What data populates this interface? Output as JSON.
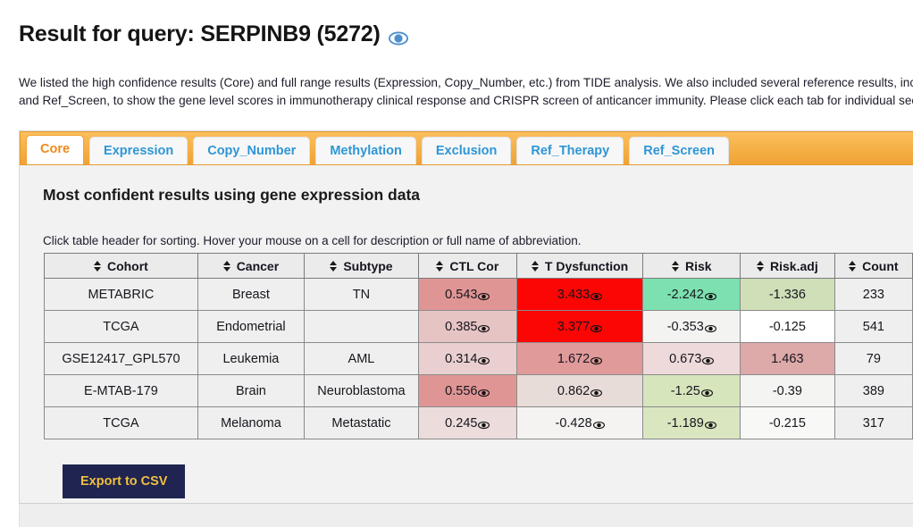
{
  "header": {
    "title": "Result for query: SERPINB9 (5272)",
    "title_eye_icon": "eye-icon",
    "description_line1": "We listed the high confidence results (Core) and full range results (Expression, Copy_Number, etc.) from TIDE analysis. We also included several reference results, incl",
    "description_line2": "and Ref_Screen, to show the gene level scores in immunotherapy clinical response and CRISPR screen of anticancer immunity. Please click each tab for individual secti"
  },
  "tabs": {
    "active_index": 0,
    "items": [
      {
        "label": "Core"
      },
      {
        "label": "Expression"
      },
      {
        "label": "Copy_Number"
      },
      {
        "label": "Methylation"
      },
      {
        "label": "Exclusion"
      },
      {
        "label": "Ref_Therapy"
      },
      {
        "label": "Ref_Screen"
      }
    ]
  },
  "panel": {
    "title": "Most confident results using gene expression data",
    "hint": "Click table header for sorting. Hover your mouse on a cell for description or full name of abbreviation.",
    "export_label": "Export to CSV"
  },
  "table": {
    "columns": [
      {
        "label": "Cohort",
        "key": "cohort"
      },
      {
        "label": "Cancer",
        "key": "cancer"
      },
      {
        "label": "Subtype",
        "key": "subtype"
      },
      {
        "label": "CTL Cor",
        "key": "ctl_cor"
      },
      {
        "label": "T Dysfunction",
        "key": "t_dysfunction"
      },
      {
        "label": "Risk",
        "key": "risk"
      },
      {
        "label": "Risk.adj",
        "key": "risk_adj"
      },
      {
        "label": "Count",
        "key": "count"
      }
    ],
    "rows": [
      {
        "cohort": "METABRIC",
        "cancer": "Breast",
        "subtype": "TN",
        "ctl_cor": "0.543",
        "ctl_cor_bg": "#e09595",
        "t_dysfunction": "3.433",
        "t_dysfunction_bg": "#fb0505",
        "risk": "-2.242",
        "risk_bg": "#7ce0b0",
        "risk_adj": "-1.336",
        "risk_adj_bg": "#cfdfb8",
        "count": "233"
      },
      {
        "cohort": "TCGA",
        "cancer": "Endometrial",
        "subtype": "",
        "ctl_cor": "0.385",
        "ctl_cor_bg": "#e7c4c4",
        "t_dysfunction": "3.377",
        "t_dysfunction_bg": "#fb0505",
        "risk": "-0.353",
        "risk_bg": "#f3f3f1",
        "risk_adj": "-0.125",
        "risk_adj_bg": "#ffffff",
        "count": "541"
      },
      {
        "cohort": "GSE12417_GPL570",
        "cancer": "Leukemia",
        "subtype": "AML",
        "ctl_cor": "0.314",
        "ctl_cor_bg": "#e9cfcf",
        "t_dysfunction": "1.672",
        "t_dysfunction_bg": "#e09a9a",
        "risk": "0.673",
        "risk_bg": "#eedada",
        "risk_adj": "1.463",
        "risk_adj_bg": "#dda9a9",
        "count": "79"
      },
      {
        "cohort": "E-MTAB-179",
        "cancer": "Brain",
        "subtype": "Neuroblastoma",
        "ctl_cor": "0.556",
        "ctl_cor_bg": "#e09595",
        "t_dysfunction": "0.862",
        "t_dysfunction_bg": "#e8dcd9",
        "risk": "-1.25",
        "risk_bg": "#d7e5bd",
        "risk_adj": "-0.39",
        "risk_adj_bg": "#f4f4f2",
        "count": "389"
      },
      {
        "cohort": "TCGA",
        "cancer": "Melanoma",
        "subtype": "Metastatic",
        "ctl_cor": "0.245",
        "ctl_cor_bg": "#ecdcdc",
        "t_dysfunction": "-0.428",
        "t_dysfunction_bg": "#f4f3f1",
        "risk": "-1.189",
        "risk_bg": "#d9e6c0",
        "risk_adj": "-0.215",
        "risk_adj_bg": "#f8f8f6",
        "count": "317"
      }
    ],
    "eye_columns": [
      "ctl_cor",
      "t_dysfunction",
      "risk"
    ],
    "cell_eye_icon": "eye-icon"
  },
  "colors": {
    "tab_bar": "#f0a233",
    "active_tab_text": "#f0891b",
    "tab_text": "#2e96d6",
    "export_bg": "#1f2450",
    "export_text": "#f0c040",
    "title_eye": "#4d8fce"
  }
}
